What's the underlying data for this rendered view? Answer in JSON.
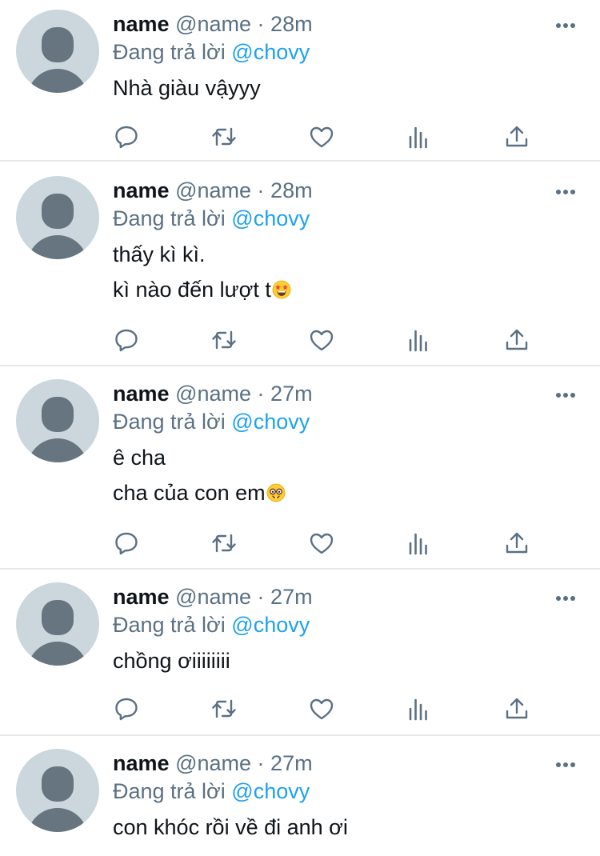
{
  "colors": {
    "text": "#0f1419",
    "secondary": "#5b7083",
    "mention": "#1da1f2",
    "divider": "#e6e9eb",
    "avatar_bg": "#ccd6dd",
    "avatar_fg": "#66757f"
  },
  "icons": {
    "reply": "speech-bubble-icon",
    "retweet": "retweet-arrows-icon",
    "like": "heart-icon",
    "analytics": "bar-chart-icon",
    "share": "share-upload-icon",
    "more": "ellipsis-icon"
  },
  "tweets": [
    {
      "name": "name",
      "handle": "@name",
      "separator": "·",
      "time": "28m",
      "replying_prefix": "Đang trả lời",
      "replying_to": "@chovy",
      "lines": [
        "Nhà giàu vậyyy"
      ]
    },
    {
      "name": "name",
      "handle": "@name",
      "separator": "·",
      "time": "28m",
      "replying_prefix": "Đang trả lời",
      "replying_to": "@chovy",
      "lines": [
        "thấy kì kì.",
        "kì nào đến lượt t"
      ],
      "emoji": "star-struck-emoji"
    },
    {
      "name": "name",
      "handle": "@name",
      "separator": "·",
      "time": "27m",
      "replying_prefix": "Đang trả lời",
      "replying_to": "@chovy",
      "lines": [
        "ê cha",
        "cha của con em"
      ],
      "emoji": "nerd-face-emoji"
    },
    {
      "name": "name",
      "handle": "@name",
      "separator": "·",
      "time": "27m",
      "replying_prefix": "Đang trả lời",
      "replying_to": "@chovy",
      "lines": [
        "chồng ơiiiiiiii"
      ]
    },
    {
      "name": "name",
      "handle": "@name",
      "separator": "·",
      "time": "27m",
      "replying_prefix": "Đang trả lời",
      "replying_to": "@chovy",
      "lines": [
        "con khóc rồi về đi anh ơi"
      ]
    }
  ]
}
